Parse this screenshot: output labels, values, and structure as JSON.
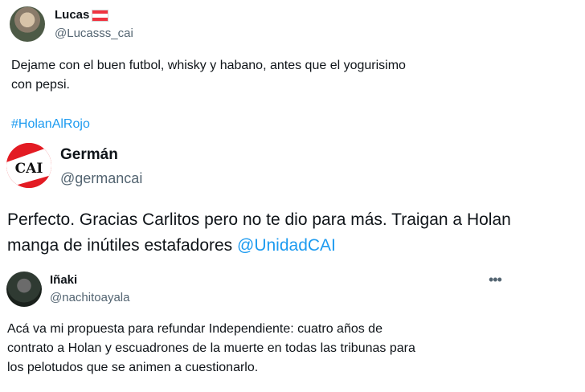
{
  "tweets": [
    {
      "name": "Lucas",
      "handle": "@Lucasss_cai",
      "text": "Dejame con el buen futbol, whisky y habano, antes que el yogurisimo\ncon pepsi.",
      "hashtag": "#HolanAlRojo",
      "flag_colors": [
        "#ef3340",
        "#ffffff",
        "#ef3340"
      ]
    },
    {
      "name": "Germán",
      "handle": "@germancai",
      "text": "Perfecto. Gracias Carlitos pero no te dio para más. Traigan a Holan\nmanga de inútiles estafadores ",
      "mention": "@UnidadCAI",
      "avatar_letters": "CAI"
    },
    {
      "name": "Iñaki",
      "handle": "@nachitoayala",
      "more_label": "•••",
      "text": "Acá va mi propuesta para refundar Independiente: cuatro años de\ncontrato a Holan y escuadrones de la muerte en todas las tribunas para\nlos pelotudos que se animen a cuestionarlo."
    }
  ],
  "colors": {
    "link": "#1d9bf0",
    "secondary_text": "#536471",
    "primary_text": "#0f1419",
    "cai_red": "#e31b23"
  }
}
